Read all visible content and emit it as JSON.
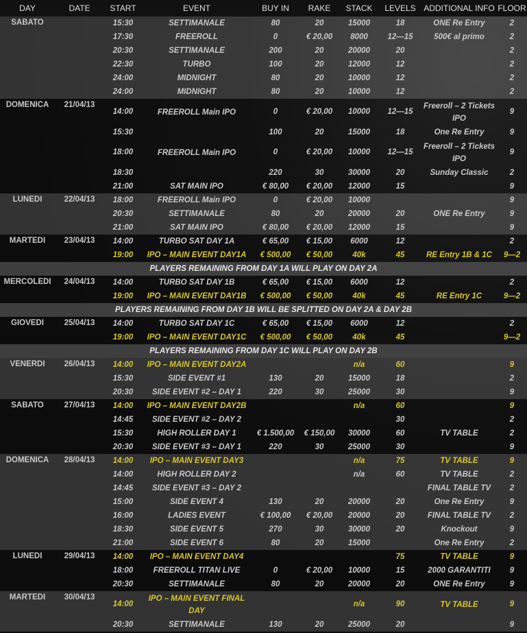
{
  "headers": [
    "DAY",
    "DATE",
    "START",
    "EVENT",
    "BUY IN",
    "RAKE",
    "STACK",
    "LEVELS",
    "ADDITIONAL INFO",
    "FLOOR"
  ],
  "groups": [
    {
      "type": "day",
      "shade": "light",
      "day": "SABATO",
      "date": "",
      "rows": [
        {
          "start": "15:30",
          "event": "SETTIMANALE",
          "buyin": "80",
          "rake": "20",
          "stack": "15000",
          "levels": "18",
          "info": "ONE Re Entry",
          "floor": "2"
        },
        {
          "start": "17:30",
          "event": "FREEROLL",
          "buyin": "0",
          "rake": "€ 20,00",
          "stack": "8000",
          "levels": "12—15",
          "info": "500€ al primo",
          "floor": "2"
        },
        {
          "start": "20:30",
          "event": "SETTIMANALE",
          "buyin": "200",
          "rake": "20",
          "stack": "20000",
          "levels": "20",
          "info": "",
          "floor": "2"
        },
        {
          "start": "22:30",
          "event": "TURBO",
          "buyin": "100",
          "rake": "20",
          "stack": "12000",
          "levels": "12",
          "info": "",
          "floor": "2"
        },
        {
          "start": "24:00",
          "event": "MIDNIGHT",
          "buyin": "80",
          "rake": "20",
          "stack": "10000",
          "levels": "12",
          "info": "",
          "floor": "2"
        },
        {
          "start": "24:00",
          "event": "MIDNIGHT",
          "buyin": "80",
          "rake": "20",
          "stack": "10000",
          "levels": "12",
          "info": "",
          "floor": "2"
        }
      ]
    },
    {
      "type": "day",
      "shade": "dark",
      "day": "DOMENICA",
      "date": "21/04/13",
      "rows": [
        {
          "tall": true,
          "start": "14:00",
          "event": "FREEROLL Main IPO",
          "buyin": "0",
          "rake": "€ 20,00",
          "stack": "10000",
          "levels": "12—15",
          "info": "Freeroll – 2 Tickets IPO",
          "floor": "9"
        },
        {
          "start": "15:30",
          "event": "",
          "buyin": "100",
          "rake": "20",
          "stack": "15000",
          "levels": "18",
          "info": "One Re Entry",
          "floor": "9"
        },
        {
          "tall": true,
          "start": "18:00",
          "event": "FREEROLL Main IPO",
          "buyin": "0",
          "rake": "€ 20,00",
          "stack": "10000",
          "levels": "12—15",
          "info": "Freeroll – 2 Tickets IPO",
          "floor": "9"
        },
        {
          "start": "18:30",
          "event": "",
          "buyin": "220",
          "rake": "30",
          "stack": "30000",
          "levels": "20",
          "info": "Sunday Classic",
          "floor": "2"
        },
        {
          "start": "21:00",
          "event": "SAT MAIN IPO",
          "buyin": "€ 80,00",
          "rake": "€ 20,00",
          "stack": "12000",
          "levels": "15",
          "info": "",
          "floor": "9"
        }
      ]
    },
    {
      "type": "day",
      "shade": "light",
      "day": "LUNEDI",
      "date": "22/04/13",
      "rows": [
        {
          "start": "18:00",
          "event": "FREEROLL Main IPO",
          "buyin": "0",
          "rake": "€ 20,00",
          "stack": "10000",
          "levels": "",
          "info": "",
          "floor": "9"
        },
        {
          "start": "20:30",
          "event": "SETTIMANALE",
          "buyin": "80",
          "rake": "20",
          "stack": "20000",
          "levels": "20",
          "info": "ONE Re Entry",
          "floor": "9"
        },
        {
          "start": "21:00",
          "event": "SAT MAIN IPO",
          "buyin": "€ 80,00",
          "rake": "€ 20,00",
          "stack": "12000",
          "levels": "15",
          "info": "",
          "floor": "9"
        }
      ]
    },
    {
      "type": "day",
      "shade": "dark",
      "day": "MARTEDI",
      "date": "23/04/13",
      "rows": [
        {
          "start": "14:00",
          "event": "TURBO SAT DAY 1A",
          "buyin": "€ 65,00",
          "rake": "€ 15,00",
          "stack": "6000",
          "levels": "12",
          "info": "",
          "floor": "2"
        },
        {
          "gold": true,
          "start": "19:00",
          "event": "IPO – MAIN EVENT DAY1A",
          "buyin": "€ 500,00",
          "rake": "€ 50,00",
          "stack": "40k",
          "levels": "45",
          "info": "RE Entry 1B & 1C",
          "floor": "9—2"
        }
      ]
    },
    {
      "type": "note",
      "text": "PLAYERS REMAINING  FROM DAY 1A WILL PLAY ON DAY 2A"
    },
    {
      "type": "day",
      "shade": "dark",
      "day": "MERCOLEDI",
      "date": "24/04/13",
      "rows": [
        {
          "start": "14:00",
          "event": "TURBO SAT DAY 1B",
          "buyin": "€ 65,00",
          "rake": "€ 15,00",
          "stack": "6000",
          "levels": "12",
          "info": "",
          "floor": "2"
        },
        {
          "gold": true,
          "start": "19:00",
          "event": "IPO – MAIN EVENT DAY1B",
          "buyin": "€ 500,00",
          "rake": "€ 50,00",
          "stack": "40k",
          "levels": "45",
          "info": "RE Entry 1C",
          "floor": "9—2"
        }
      ]
    },
    {
      "type": "note",
      "text": "PLAYERS REMAINING FROM DAY 1B WILL BE SPLITTED ON DAY 2A & DAY 2B"
    },
    {
      "type": "day",
      "shade": "dark",
      "day": "GIOVEDI",
      "date": "25/04/13",
      "rows": [
        {
          "start": "14:00",
          "event": "TURBO SAT DAY 1C",
          "buyin": "€ 65,00",
          "rake": "€ 15,00",
          "stack": "6000",
          "levels": "12",
          "info": "",
          "floor": "2"
        },
        {
          "gold": true,
          "start": "19:00",
          "event": "IPO – MAIN EVENT DAY1C",
          "buyin": "€ 500,00",
          "rake": "€ 50,00",
          "stack": "40k",
          "levels": "45",
          "info": "",
          "floor": "9—2"
        }
      ]
    },
    {
      "type": "note",
      "text": "PLAYERS REMAINING FROM DAY 1C WILL PLAY ON DAY 2B"
    },
    {
      "type": "day",
      "shade": "light",
      "day": "VENERDI",
      "date": "26/04/13",
      "rows": [
        {
          "gold": true,
          "start": "14:00",
          "event": "IPO – MAIN EVENT DAY2A",
          "buyin": "",
          "rake": "",
          "stack": "n/a",
          "levels": "60",
          "info": "",
          "floor": "9"
        },
        {
          "start": "15:30",
          "event": "SIDE EVENT #1",
          "buyin": "130",
          "rake": "20",
          "stack": "15000",
          "levels": "18",
          "info": "",
          "floor": "2"
        },
        {
          "start": "20:30",
          "event": "SIDE EVENT #2 – DAY 1",
          "buyin": "220",
          "rake": "30",
          "stack": "25000",
          "levels": "30",
          "info": "",
          "floor": "9"
        }
      ]
    },
    {
      "type": "day",
      "shade": "dark",
      "day": "SABATO",
      "date": "27/04/13",
      "rows": [
        {
          "gold": true,
          "start": "14:00",
          "event": "IPO – MAIN EVENT DAY2B",
          "buyin": "",
          "rake": "",
          "stack": "n/a",
          "levels": "60",
          "info": "",
          "floor": "9"
        },
        {
          "start": "14:45",
          "event": "SIDE EVENT #2 – DAY 2",
          "buyin": "",
          "rake": "",
          "stack": "",
          "levels": "30",
          "info": "",
          "floor": "2"
        },
        {
          "start": "15:30",
          "event": "HIGH ROLLER DAY 1",
          "buyin": "€ 1.500,00",
          "rake": "€ 150,00",
          "stack": "30000",
          "levels": "60",
          "info": "TV TABLE",
          "floor": "2"
        },
        {
          "start": "20:30",
          "event": "SIDE EVENT #3 – DAY 1",
          "buyin": "220",
          "rake": "30",
          "stack": "25000",
          "levels": "30",
          "info": "",
          "floor": "9"
        }
      ]
    },
    {
      "type": "day",
      "shade": "light",
      "day": "DOMENICA",
      "date": "28/04/13",
      "rows": [
        {
          "gold": true,
          "start": "14:00",
          "event": "IPO – MAIN EVENT DAY3",
          "buyin": "",
          "rake": "",
          "stack": "n/a",
          "levels": "75",
          "info": "TV TABLE",
          "floor": "9"
        },
        {
          "start": "14:00",
          "event": "HIGH ROLLER DAY 2",
          "buyin": "",
          "rake": "",
          "stack": "n/a",
          "levels": "60",
          "info": "TV TABLE",
          "floor": "2"
        },
        {
          "start": "14:45",
          "event": "SIDE EVENT #3 – DAY 2",
          "buyin": "",
          "rake": "",
          "stack": "",
          "levels": "",
          "info": "FINAL TABLE TV",
          "floor": "2"
        },
        {
          "start": "15:00",
          "event": "SIDE EVENT 4",
          "buyin": "130",
          "rake": "20",
          "stack": "20000",
          "levels": "20",
          "info": "One Re Entry",
          "floor": "9"
        },
        {
          "start": "16:00",
          "event": "LADIES EVENT",
          "buyin": "€ 100,00",
          "rake": "€ 20,00",
          "stack": "20000",
          "levels": "20",
          "info": "FINAL TABLE TV",
          "floor": "2"
        },
        {
          "start": "18:30",
          "event": "SIDE EVENT 5",
          "buyin": "270",
          "rake": "30",
          "stack": "30000",
          "levels": "20",
          "info": "Knockout",
          "floor": "9"
        },
        {
          "start": "21:00",
          "event": "SIDE EVENT 6",
          "buyin": "80",
          "rake": "20",
          "stack": "15000",
          "levels": "",
          "info": "One Re Entry",
          "floor": "2"
        }
      ]
    },
    {
      "type": "day",
      "shade": "dark",
      "day": "LUNEDI",
      "date": "29/04/13",
      "rows": [
        {
          "gold": true,
          "start": "14:00",
          "event": "IPO – MAIN EVENT DAY4",
          "buyin": "",
          "rake": "",
          "stack": "",
          "levels": "75",
          "info": "TV TABLE",
          "floor": "9"
        },
        {
          "start": "18:00",
          "event": "FREEROLL TITAN LIVE",
          "buyin": "0",
          "rake": "€ 20,00",
          "stack": "10000",
          "levels": "15",
          "info": "2000 GARANTITI",
          "floor": "9"
        },
        {
          "start": "20:30",
          "event": "SETTIMANALE",
          "buyin": "80",
          "rake": "20",
          "stack": "20000",
          "levels": "20",
          "info": "ONE Re Entry",
          "floor": "9"
        }
      ]
    },
    {
      "type": "day",
      "shade": "light",
      "day": "MARTEDI",
      "date": "30/04/13",
      "rows": [
        {
          "gold": true,
          "tall": true,
          "start": "14:00",
          "event": "IPO – MAIN EVENT FINAL DAY",
          "buyin": "",
          "rake": "",
          "stack": "n/a",
          "levels": "90",
          "info": "TV TABLE",
          "floor": "9"
        },
        {
          "start": "20:30",
          "event": "SETTIMANALE",
          "buyin": "130",
          "rake": "20",
          "stack": "25000",
          "levels": "20",
          "info": "",
          "floor": "9"
        }
      ]
    }
  ]
}
